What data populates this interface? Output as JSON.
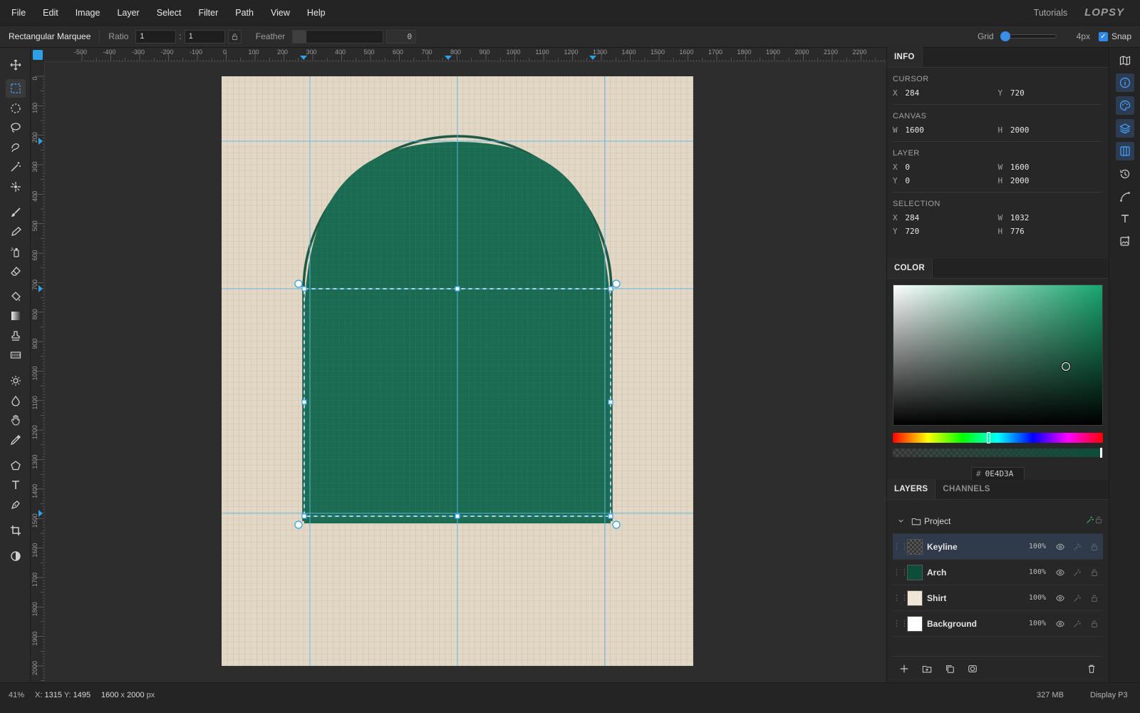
{
  "menu": {
    "items": [
      "File",
      "Edit",
      "Image",
      "Layer",
      "Select",
      "Filter",
      "Path",
      "View",
      "Help"
    ],
    "tutorials": "Tutorials",
    "logo": "LOPSY"
  },
  "options": {
    "tool_name": "Rectangular Marquee",
    "ratio_label": "Ratio",
    "ratio_w": "1",
    "ratio_sep": ":",
    "ratio_h": "1",
    "feather_label": "Feather",
    "feather_value": "0",
    "grid_label": "Grid",
    "grid_size": "4px",
    "snap_label": "Snap",
    "snap_checked": true
  },
  "tools": [
    "move-icon",
    "rect-marquee-icon",
    "ellipse-marquee-icon",
    "lasso-icon",
    "quick-select-icon",
    "magic-wand-icon",
    "spot-heal-icon",
    "brush-icon",
    "pencil-icon",
    "spray-icon",
    "eraser-icon",
    "bucket-icon",
    "gradient-icon",
    "stamp-icon",
    "pattern-icon",
    "dodge-icon",
    "blur-icon",
    "hand-icon",
    "eyedropper-icon",
    "polygon-icon",
    "text-icon",
    "pen-icon",
    "crop-icon",
    "contrast-icon"
  ],
  "rulers": {
    "h_labels": [
      "-500",
      "-400",
      "-300",
      "-200",
      "-100",
      "0",
      "100",
      "200",
      "300",
      "400",
      "500",
      "600",
      "700",
      "800",
      "900",
      "1000",
      "1100",
      "1200",
      "1300",
      "1400",
      "1500",
      "1600",
      "1700",
      "1800",
      "1900",
      "2000",
      "2100",
      "2200"
    ],
    "v_labels": [
      "0",
      "100",
      "200",
      "300",
      "400",
      "500",
      "600",
      "700",
      "800",
      "900",
      "1000",
      "1100",
      "1200",
      "1300",
      "1400",
      "1500",
      "1600",
      "1700",
      "1800",
      "1900",
      "2000"
    ]
  },
  "info": {
    "tab": "INFO",
    "cursor": {
      "title": "CURSOR",
      "x_label": "X",
      "x": "284",
      "y_label": "Y",
      "y": "720"
    },
    "canvas": {
      "title": "CANVAS",
      "w_label": "W",
      "w": "1600",
      "h_label": "H",
      "h": "2000"
    },
    "layer": {
      "title": "LAYER",
      "x_label": "X",
      "x": "0",
      "w_label": "W",
      "w": "1600",
      "y_label": "Y",
      "y": "0",
      "h_label": "H",
      "h": "2000"
    },
    "selection": {
      "title": "SELECTION",
      "x_label": "X",
      "x": "284",
      "w_label": "W",
      "w": "1032",
      "y_label": "Y",
      "y": "720",
      "h_label": "H",
      "h": "776"
    }
  },
  "color": {
    "tab": "COLOR",
    "hex_symbol": "#",
    "hex": "0E4D3A",
    "value_hex": "#0e4d3a"
  },
  "layers": {
    "tab_layers": "LAYERS",
    "tab_channels": "CHANNELS",
    "group": "Project",
    "items": [
      {
        "name": "Keyline",
        "opacity": "100%",
        "thumb": "checker",
        "selected": true
      },
      {
        "name": "Arch",
        "opacity": "100%",
        "thumb": "#0e4d3a",
        "selected": false
      },
      {
        "name": "Shirt",
        "opacity": "100%",
        "thumb": "#efe6d8",
        "selected": false
      },
      {
        "name": "Background",
        "opacity": "100%",
        "thumb": "#ffffff",
        "selected": false
      }
    ]
  },
  "status": {
    "zoom": "41%",
    "coords_x_label": "X:",
    "coords_x": "1315",
    "coords_y_label": "Y:",
    "coords_y": "1495",
    "doc_w": "1600",
    "doc_x": "x",
    "doc_h": "2000",
    "doc_unit": "px",
    "memory": "327 MB",
    "display": "Display P3"
  },
  "colors": {
    "accent": "#2f9fe6",
    "arch": "#1b6b52",
    "keyline": "#1f5a47",
    "shirt": "#e3d8c6",
    "guide": "#5bb8e6"
  }
}
